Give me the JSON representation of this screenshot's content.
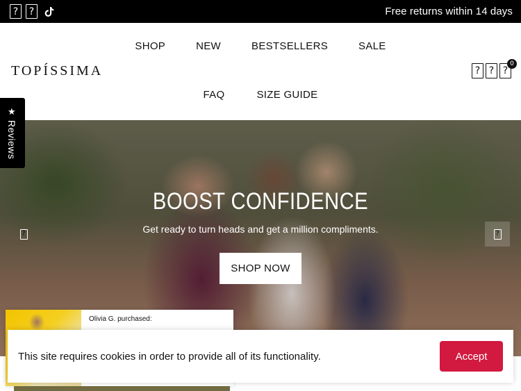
{
  "topbar": {
    "social_icons": [
      "facebook-icon",
      "instagram-icon",
      "tiktok-icon"
    ],
    "promo": "Free returns within 14 days"
  },
  "header": {
    "logo": "TOPÍSSIMA",
    "nav_row1": [
      "SHOP",
      "NEW",
      "BESTSELLERS",
      "SALE"
    ],
    "nav_row2": [
      "FAQ",
      "SIZE GUIDE"
    ],
    "cart_count": "0",
    "icons": [
      "search-icon",
      "account-icon",
      "cart-icon"
    ]
  },
  "reviews_tab": {
    "label": "Reviews",
    "icon": "star-icon"
  },
  "hero": {
    "title": "BOOST CONFIDENCE",
    "subtitle": "Get ready to turn heads and get a million compliments.",
    "cta": "SHOP NOW"
  },
  "purchase_popup": {
    "text": "Olivia G. purchased:"
  },
  "cookie_banner": {
    "message": "This site requires cookies in order to provide all of its functionality.",
    "accept": "Accept",
    "accent_color": "#d21940"
  },
  "glyphs": {
    "missing": "?",
    "tiktok": "♪",
    "star": "★"
  }
}
